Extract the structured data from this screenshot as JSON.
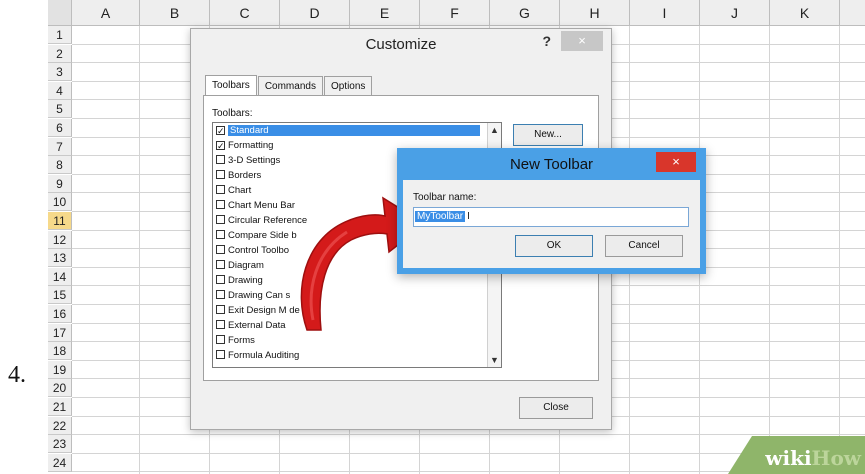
{
  "step_number": "4.",
  "sheet": {
    "columns": [
      "A",
      "B",
      "C",
      "D",
      "E",
      "F",
      "G",
      "H",
      "I",
      "J",
      "K"
    ],
    "rows": [
      "1",
      "2",
      "3",
      "4",
      "5",
      "6",
      "7",
      "8",
      "9",
      "10",
      "11",
      "12",
      "13",
      "14",
      "15",
      "16",
      "17",
      "18",
      "19",
      "20",
      "21",
      "22",
      "23",
      "24"
    ],
    "selected_row": "11",
    "selected_row_color": "#f6d98a"
  },
  "customize": {
    "title": "Customize",
    "help_icon": "?",
    "close_icon": "×",
    "tabs": [
      {
        "label": "Toolbars"
      },
      {
        "label": "Commands"
      },
      {
        "label": "Options"
      }
    ],
    "toolbars_label": "Toolbars:",
    "toolbars": [
      {
        "label": "Standard",
        "checked": true,
        "selected": true
      },
      {
        "label": "Formatting",
        "checked": true
      },
      {
        "label": "3-D Settings",
        "checked": false
      },
      {
        "label": "Borders",
        "checked": false
      },
      {
        "label": "Chart",
        "checked": false
      },
      {
        "label": "Chart Menu Bar",
        "checked": false
      },
      {
        "label": "Circular Reference",
        "checked": false
      },
      {
        "label": "Compare Side b",
        "checked": false
      },
      {
        "label": "Control Toolbo",
        "checked": false
      },
      {
        "label": "Diagram",
        "checked": false
      },
      {
        "label": "Drawing",
        "checked": false
      },
      {
        "label": "Drawing Can  s",
        "checked": false
      },
      {
        "label": "Exit Design M de",
        "checked": false
      },
      {
        "label": "External Data",
        "checked": false
      },
      {
        "label": "Forms",
        "checked": false
      },
      {
        "label": "Formula Auditing",
        "checked": false
      }
    ],
    "new_button": "New...",
    "close_button": "Close"
  },
  "new_toolbar": {
    "title": "New Toolbar",
    "close_icon": "×",
    "name_label": "Toolbar name:",
    "name_value": "MyToolbar",
    "ok_button": "OK",
    "cancel_button": "Cancel"
  },
  "watermark": {
    "part1": "wiki",
    "part2": "How"
  },
  "colors": {
    "accent": "#3a8ee6",
    "dialog_border": "#4aa0e6",
    "arrow": "#d41a1a",
    "close_red": "#d9362b"
  }
}
